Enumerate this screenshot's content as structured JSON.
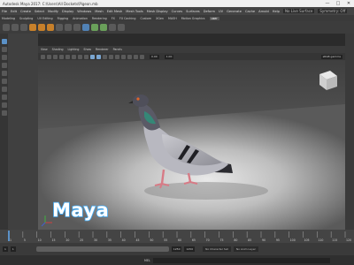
{
  "window": {
    "title": "Autodesk Maya 2017: C:\\Users\\All Dockets\\Pigeon.mb",
    "controls": [
      "—",
      "□",
      "✕"
    ]
  },
  "menubar": {
    "items": [
      "File",
      "Edit",
      "Create",
      "Select",
      "Modify",
      "Display",
      "Windows",
      "Mesh",
      "Edit Mesh",
      "Mesh Tools",
      "Mesh Display",
      "Curves",
      "Surfaces",
      "Deform",
      "UV",
      "Generate",
      "Cache",
      "Arnold",
      "Help"
    ],
    "live_surface": "No Live Surface",
    "symmetry": "Symmetry: Off"
  },
  "shelf_tabs": {
    "items": [
      "Modeling",
      "Sculpting",
      "UV Editing",
      "Rigging",
      "Animation",
      "Rendering",
      "FX",
      "FX Caching",
      "Custom",
      "XGen",
      "MASH",
      "Motion Graphics",
      "user"
    ],
    "active_index": 12
  },
  "panel": {
    "menus": [
      "View",
      "Shading",
      "Lighting",
      "Show",
      "Renderer",
      "Panels"
    ],
    "exposure": "0.00",
    "gamma": "1.00",
    "color_space": "sRGB gamma"
  },
  "viewport": {
    "logo_text": "Maya",
    "logo_color": "#3fa9f5"
  },
  "timeline": {
    "ticks": [
      "1",
      "5",
      "10",
      "15",
      "20",
      "25",
      "30",
      "35",
      "40",
      "45",
      "50",
      "55",
      "60",
      "65",
      "70",
      "75",
      "80",
      "85",
      "90",
      "95",
      "100",
      "105",
      "110",
      "115",
      "120"
    ]
  },
  "range": {
    "start": "1",
    "anim_start": "1",
    "anim_end": "1250",
    "end": "1250",
    "character": "No Character Set",
    "anim_layer": "No Anim Layer"
  },
  "command_line": {
    "label": "MEL"
  },
  "colors": {
    "accent": "#5b91c7",
    "background": "#2b2b2b"
  }
}
